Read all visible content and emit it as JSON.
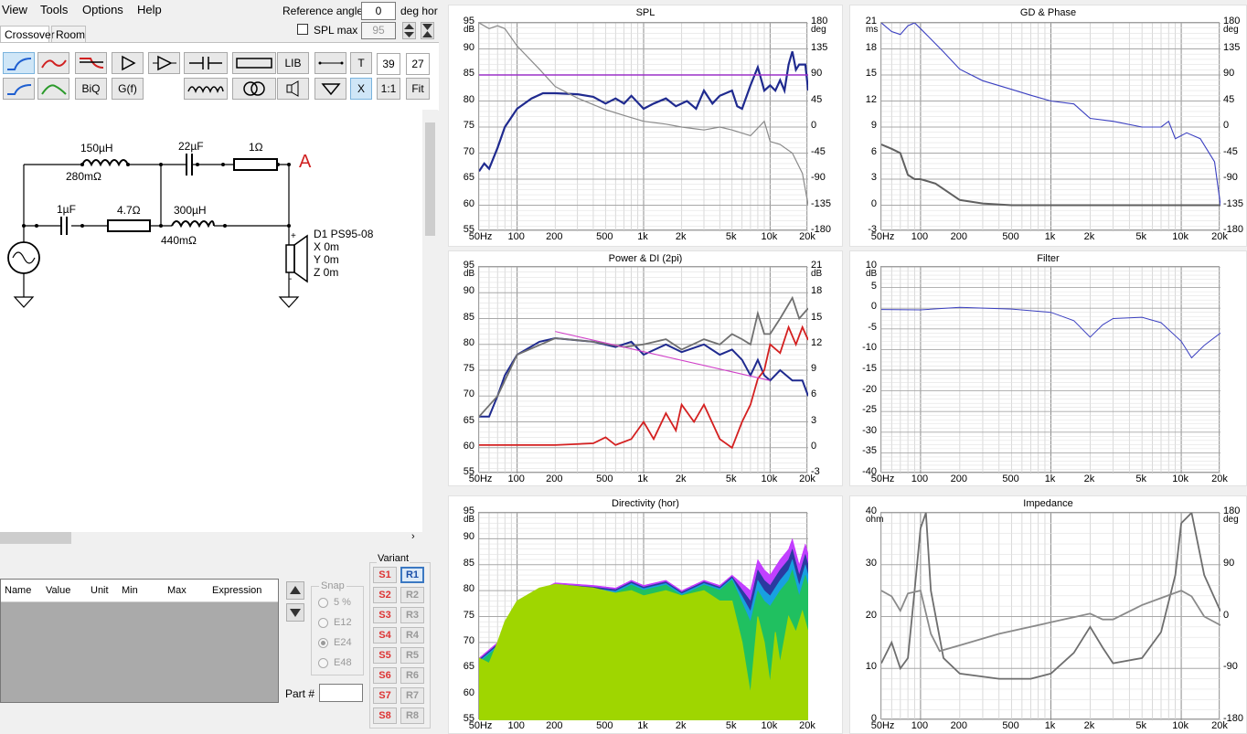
{
  "menu": [
    "View",
    "Tools",
    "Options",
    "Help"
  ],
  "reference": {
    "label": "Reference angle",
    "value": "0",
    "unit": "deg hor",
    "spl_max_label": "SPL max",
    "spl_max_value": "95"
  },
  "tabs": [
    "Crossover",
    "Room"
  ],
  "toolbar": {
    "lib": "LIB",
    "t": "T",
    "n39": "39",
    "n27": "27",
    "biq": "BiQ",
    "gf": "G(f)",
    "x": "X",
    "one": "1:1",
    "fit": "Fit"
  },
  "schematic": {
    "l1": "150µH",
    "r_l1": "280mΩ",
    "c1": "22µF",
    "r1": "1Ω",
    "node": "A",
    "c2": "1µF",
    "r2": "4.7Ω",
    "l2": "300µH",
    "r_l2": "440mΩ",
    "driver": [
      "D1 PS95-08",
      "X 0m",
      "Y 0m",
      "Z 0m"
    ]
  },
  "params": {
    "headers": [
      "Name",
      "Value",
      "Unit",
      "Min",
      "Max",
      "Expression"
    ]
  },
  "snap": {
    "label": "Snap",
    "options": [
      "5 %",
      "E12",
      "E24",
      "E48"
    ],
    "selected": "E24"
  },
  "part_label": "Part #",
  "variant": {
    "label": "Variant",
    "s": [
      "S1",
      "S2",
      "S3",
      "S4",
      "S5",
      "S6",
      "S7",
      "S8"
    ],
    "r": [
      "R1",
      "R2",
      "R3",
      "R4",
      "R5",
      "R6",
      "R7",
      "R8"
    ],
    "active": "R1"
  },
  "freq_ticks": [
    "50Hz",
    "100",
    "200",
    "500",
    "1k",
    "2k",
    "5k",
    "10k",
    "20k"
  ],
  "colors": {
    "navy": "#1f2a8f",
    "gray": "#8a8a8a",
    "purple": "#9b30c8",
    "red": "#d42020",
    "blue": "#3a3fc0",
    "pink": "#d040c8",
    "green": "#9fd600"
  },
  "charts": [
    {
      "title": "SPL",
      "left_unit": "dB",
      "right_unit": "deg",
      "left": [
        "95",
        "90",
        "85",
        "80",
        "75",
        "70",
        "65",
        "60",
        "55"
      ],
      "right": [
        "180",
        "135",
        "90",
        "45",
        "0",
        "-45",
        "-90",
        "-135",
        "-180"
      ]
    },
    {
      "title": "GD & Phase",
      "left_unit": "ms",
      "right_unit": "deg",
      "left": [
        "21",
        "18",
        "15",
        "12",
        "9",
        "6",
        "3",
        "0",
        "-3"
      ],
      "right": [
        "180",
        "135",
        "90",
        "45",
        "0",
        "-45",
        "-90",
        "-135",
        "-180"
      ]
    },
    {
      "title": "Power & DI (2pi)",
      "left_unit": "dB",
      "right_unit": "dB",
      "left": [
        "95",
        "90",
        "85",
        "80",
        "75",
        "70",
        "65",
        "60",
        "55"
      ],
      "right": [
        "21",
        "18",
        "15",
        "12",
        "9",
        "6",
        "3",
        "0",
        "-3"
      ]
    },
    {
      "title": "Filter",
      "left_unit": "dB",
      "right_unit": "",
      "left": [
        "10",
        "5",
        "0",
        "-5",
        "-10",
        "-15",
        "-20",
        "-25",
        "-30",
        "-35",
        "-40"
      ],
      "right": []
    },
    {
      "title": "Directivity (hor)",
      "left_unit": "dB",
      "right_unit": "",
      "left": [
        "95",
        "90",
        "85",
        "80",
        "75",
        "70",
        "65",
        "60",
        "55"
      ],
      "right": []
    },
    {
      "title": "Impedance",
      "left_unit": "ohm",
      "right_unit": "deg",
      "left": [
        "40",
        "30",
        "20",
        "10",
        "0"
      ],
      "right": [
        "180",
        "90",
        "0",
        "-90",
        "-180"
      ]
    }
  ]
}
